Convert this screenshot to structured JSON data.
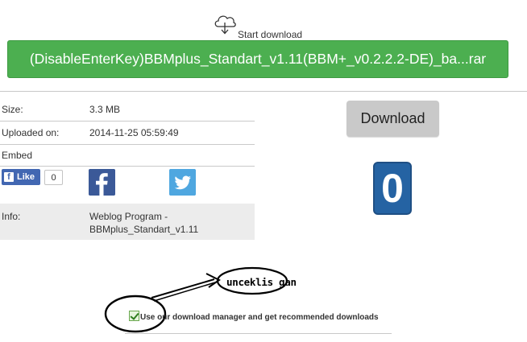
{
  "header": {
    "cloud_icon": "cloud-download-icon",
    "start_label": "Start download",
    "file_button_label": "(DisableEnterKey)BBMplus_Standart_v1.11(BBM+_v0.2.2.2-DE)_ba...rar",
    "file_button_color": "#4caf50"
  },
  "details": {
    "size_label": "Size:",
    "size_value": "3.3 MB",
    "uploaded_label": "Uploaded on:",
    "uploaded_value": "2014-11-25 05:59:49",
    "embed_label": "Embed",
    "info_label": "Info:",
    "info_value_line1": "Weblog Program -",
    "info_value_line2": "BBMplus_Standart_v1.11"
  },
  "social": {
    "like_label": "Like",
    "like_count": "0",
    "facebook_icon": "facebook-icon",
    "twitter_icon": "twitter-icon"
  },
  "side": {
    "download_label": "Download",
    "counter_value": "0",
    "counter_color": "#2563a3"
  },
  "annotation": {
    "note": "unceklis gan"
  },
  "consent": {
    "checked": true,
    "label": "Use our download manager and get recommended downloads"
  }
}
